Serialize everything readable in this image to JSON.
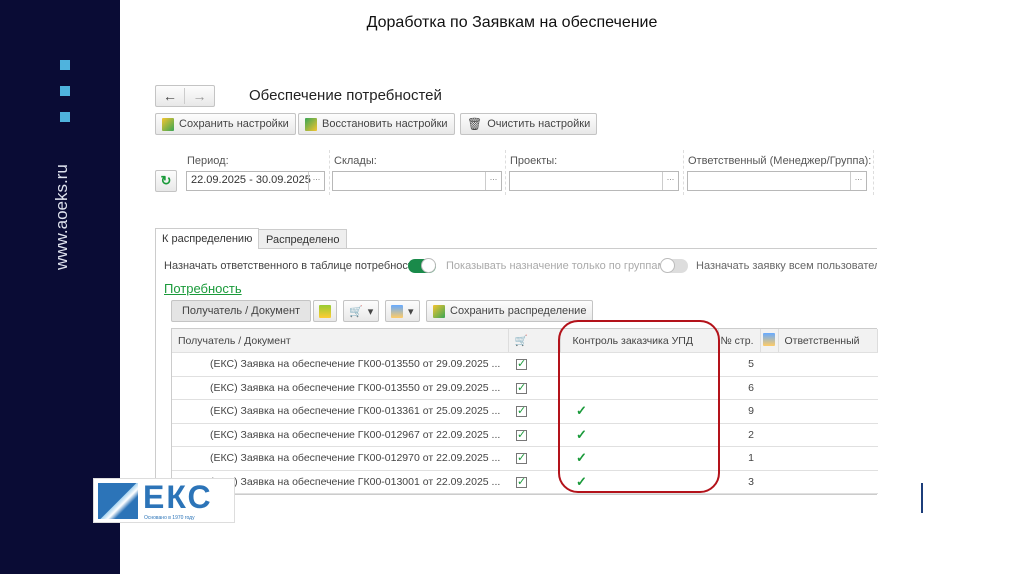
{
  "slide": {
    "title": "Доработка по Заявкам на обеспечение",
    "website": "www.aoeks.ru",
    "logo_text": "ЕКС",
    "logo_subtitle": "Основано в 1970 году"
  },
  "form": {
    "title": "Обеспечение потребностей",
    "buttons": {
      "save": "Сохранить настройки",
      "restore": "Восстановить настройки",
      "clear": "Очистить настройки"
    },
    "filters": {
      "period_label": "Период:",
      "period_value": "22.09.2025 - 30.09.2025",
      "warehouses_label": "Склады:",
      "projects_label": "Проекты:",
      "responsible_label": "Ответственный (Менеджер/Группа):",
      "dots": "..."
    },
    "tabs": [
      "К распределению",
      "Распределено"
    ],
    "toggles": {
      "assign_label": "Назначать ответственного в таблице потребности:",
      "groups_label": "Показывать назначение только по группам:",
      "all_users_label": "Назначать заявку всем пользователя"
    },
    "section_link": "Потребность",
    "toolbar": {
      "group_button": "Получатель / Документ",
      "save_distribution": "Сохранить распределение"
    },
    "table": {
      "columns": [
        "Получатель / Документ",
        "",
        "Контроль заказчика УПД",
        "№ стр.",
        "",
        "Ответственный"
      ],
      "rows": [
        {
          "doc": "(ЕКС) Заявка на обеспечение ГК00-013550 от 29.09.2025 ...",
          "cart": true,
          "control": false,
          "line": "5"
        },
        {
          "doc": "(ЕКС) Заявка на обеспечение ГК00-013550 от 29.09.2025 ...",
          "cart": true,
          "control": false,
          "line": "6"
        },
        {
          "doc": "(ЕКС) Заявка на обеспечение ГК00-013361 от 25.09.2025 ...",
          "cart": true,
          "control": true,
          "line": "9"
        },
        {
          "doc": "(ЕКС) Заявка на обеспечение ГК00-012967 от 22.09.2025 ...",
          "cart": true,
          "control": true,
          "line": "2"
        },
        {
          "doc": "(ЕКС) Заявка на обеспечение ГК00-012970 от 22.09.2025 ...",
          "cart": true,
          "control": true,
          "line": "1"
        },
        {
          "doc": "(ЕКС) Заявка на обеспечение ГК00-013001 от 22.09.2025 ...",
          "cart": true,
          "control": true,
          "line": "3"
        }
      ]
    }
  },
  "colors": {
    "sidebar": "#0a0c35",
    "accent": "#4fb3dd",
    "highlight": "#b3121a",
    "green": "#1a9a3a"
  }
}
